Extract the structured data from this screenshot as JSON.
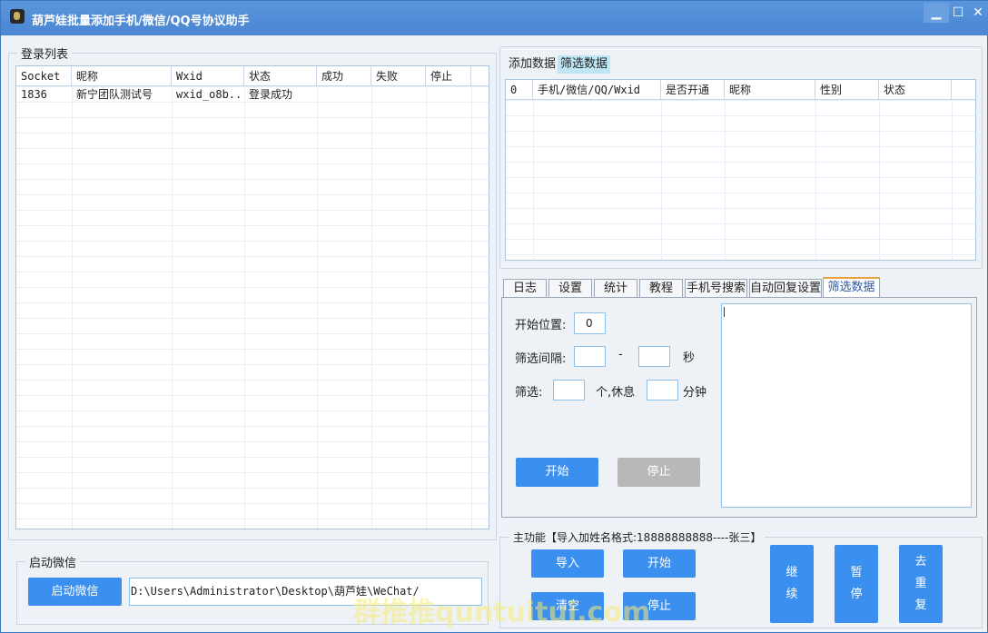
{
  "window": {
    "title": "葫芦娃批量添加手机/微信/QQ号协议助手",
    "controls": {
      "min": "▁",
      "max": "☐",
      "close": "✕"
    }
  },
  "login_list": {
    "label": "登录列表",
    "columns": [
      "Socket",
      "昵称",
      "Wxid",
      "状态",
      "成功",
      "失败",
      "停止"
    ],
    "rows": [
      {
        "socket": "1836",
        "nickname": "新宁团队测试号",
        "wxid": "wxid_o8b...",
        "status": "登录成功",
        "success": "",
        "fail": "",
        "stop": ""
      }
    ]
  },
  "start_wechat": {
    "label": "启动微信",
    "button": "启动微信",
    "path_value": "D:\\Users\\Administrator\\Desktop\\葫芦娃\\WeChat/"
  },
  "data_tabs": {
    "items": [
      "添加数据",
      "筛选数据"
    ],
    "active": 1
  },
  "filter_grid": {
    "columns": [
      "0",
      "手机/微信/QQ/Wxid",
      "是否开通",
      "昵称",
      "性别",
      "状态"
    ]
  },
  "func_tabs": {
    "items": [
      "日志",
      "设置",
      "统计",
      "教程",
      "手机号搜索",
      "自动回复设置",
      "筛选数据"
    ],
    "active": 6
  },
  "filter_panel": {
    "start_pos_label": "开始位置:",
    "start_pos_value": "0",
    "interval_label": "筛选间隔:",
    "interval_from": "",
    "interval_dash": "-",
    "interval_to": "",
    "interval_unit": "秒",
    "filter_label": "筛选:",
    "filter_count": "",
    "filter_mid": "个,休息",
    "rest_value": "",
    "rest_unit": "分钟",
    "start_button": "开始",
    "stop_button": "停止"
  },
  "main_func": {
    "label": "主功能【导入加姓名格式:18888888888----张三】",
    "import": "导入",
    "start": "开始",
    "clear": "清空",
    "stop": "停止",
    "continue_chars": [
      "继",
      "续"
    ],
    "pause_chars": [
      "暂",
      "停"
    ],
    "dedupe_chars": [
      "去",
      "重",
      "复"
    ]
  },
  "watermark": "群推推quntuitui.com",
  "colors": {
    "accent": "#3b8fee",
    "titlebar": "#4a86d2",
    "disabled": "#b8b8b8"
  }
}
